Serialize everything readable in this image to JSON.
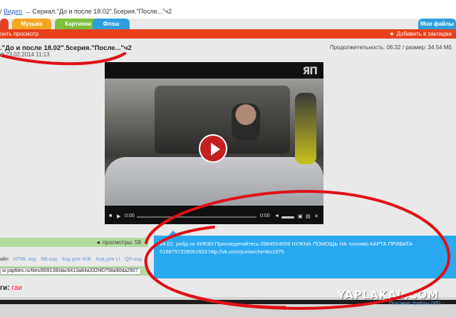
{
  "breadcrumb": {
    "prefix": "/ ",
    "link": "Видео",
    "sep": " → ",
    "current": "Сериал.\"До и после 18.02\".5серия.\"После...\"ч2"
  },
  "tabs": [
    "Музыка",
    "Картинки",
    "Флэш"
  ],
  "tabs_right": "Мои файлы",
  "redbar": {
    "left": "онть просмотр",
    "right": "Добавить в закладки"
  },
  "video": {
    "title": ".\"До и после 18.02\".5серия.\"После...\"ч2",
    "date": "23.02.2014 11:13",
    "info": "Продолжительность: 06:32 / размер: 34.54 Мб",
    "logo": "ЯП",
    "time_left": "0:00",
    "time_right": "0:00"
  },
  "stats": {
    "views": "◄ просмотры: 58"
  },
  "embed": {
    "codes": [
      "айл",
      "HTML код",
      "BB-код",
      "Код для ЖЖ",
      "Код для LI",
      "QR-код"
    ],
    "link": "w.yapfiles.ru/files/809138/dac6413a84a332f40758a90da2907"
  },
  "tags": {
    "label": "ги:",
    "value": "гаи"
  },
  "comment": {
    "text": "24.02. рейд по КИЕВУ.Присоеденяйтесь.0984554659.НУЖНА ПОМОЩЬ НА топливо.КАРТА ПРИВАТА 5168757228561603 http://vk.com/yuriiarchenko1975"
  },
  "footer": {
    "more_files": "Похожие файлы (85) ↓",
    "watermark": "YAPLAKAL.COM"
  },
  "colors": {
    "accent_red": "#e8401c",
    "tab_blue": "#2d9fe0",
    "comment_blue": "#2aa8f0",
    "stats_green": "#b2dba0"
  }
}
